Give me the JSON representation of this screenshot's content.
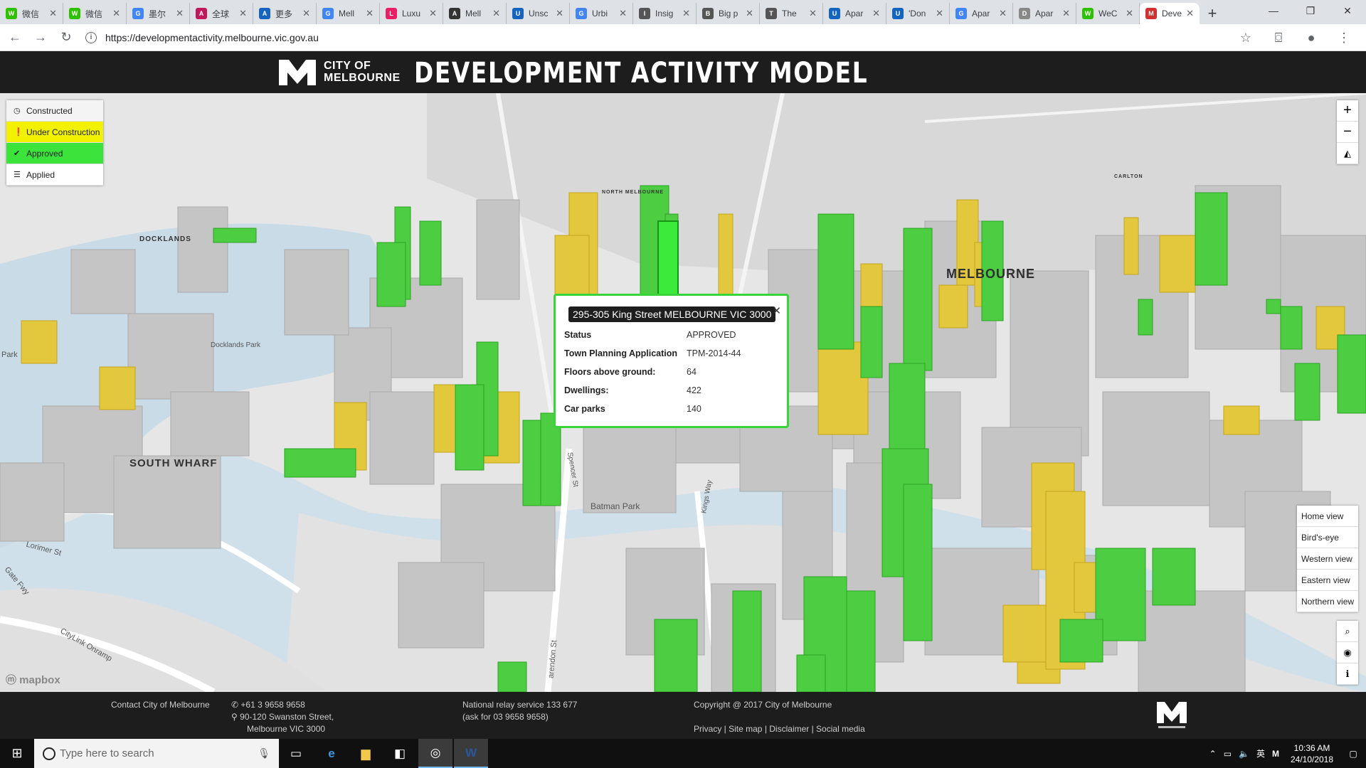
{
  "browser": {
    "tabs": [
      {
        "title": "微信",
        "color": "#2dc100",
        "glyph": "W"
      },
      {
        "title": "微信",
        "color": "#2dc100",
        "glyph": "W"
      },
      {
        "title": "墨尔",
        "color": "#4285f4",
        "glyph": "G"
      },
      {
        "title": "全球",
        "color": "#c2185b",
        "glyph": "A"
      },
      {
        "title": "更多",
        "color": "#1565c0",
        "glyph": "A"
      },
      {
        "title": "Mell",
        "color": "#4285f4",
        "glyph": "G"
      },
      {
        "title": "Luxu",
        "color": "#e91e63",
        "glyph": "L"
      },
      {
        "title": "Mell",
        "color": "#333333",
        "glyph": "A"
      },
      {
        "title": "Unsc",
        "color": "#1565c0",
        "glyph": "U"
      },
      {
        "title": "Urbi",
        "color": "#4285f4",
        "glyph": "G"
      },
      {
        "title": "Insig",
        "color": "#555555",
        "glyph": "I"
      },
      {
        "title": "Big p",
        "color": "#555555",
        "glyph": "B"
      },
      {
        "title": "The",
        "color": "#555555",
        "glyph": "T"
      },
      {
        "title": "Apar",
        "color": "#1565c0",
        "glyph": "U"
      },
      {
        "title": "'Don",
        "color": "#1565c0",
        "glyph": "U"
      },
      {
        "title": "Apar",
        "color": "#4285f4",
        "glyph": "G"
      },
      {
        "title": "Apar",
        "color": "#888888",
        "glyph": "D"
      },
      {
        "title": "WeC",
        "color": "#2dc100",
        "glyph": "W"
      },
      {
        "title": "Deve",
        "color": "#d32f2f",
        "glyph": "M"
      }
    ],
    "url": "https://developmentactivity.melbourne.vic.gov.au"
  },
  "header": {
    "logo_line1": "CITY OF",
    "logo_line2": "MELBOURNE",
    "title": "DEVELOPMENT ACTIVITY MODEL"
  },
  "legend": {
    "items": [
      {
        "label": "Constructed",
        "icon": "clock-icon",
        "bg": "#f4f4f4",
        "glyph": "◷"
      },
      {
        "label": "Under Construction",
        "icon": "warning-icon",
        "bg": "#f2f200",
        "glyph": "❗"
      },
      {
        "label": "Approved",
        "icon": "check-icon",
        "bg": "#3be33b",
        "glyph": "✔"
      },
      {
        "label": "Applied",
        "icon": "list-icon",
        "bg": "#ffffff",
        "glyph": "☰"
      }
    ]
  },
  "map": {
    "labels": {
      "docklands": "DOCKLANDS",
      "melbourne": "MELBOURNE",
      "south_wharf": "SOUTH WHARF",
      "batman_park": "Batman Park",
      "docklands_park": "Docklands Park",
      "park": "Park",
      "spencer_st": "Spencer St",
      "kings_way": "Kings Way",
      "lorimer_st": "Lorimer St",
      "citylink": "CityLink Onramp",
      "gate_fwy": "Gate Fwy",
      "clarendon_st": "arendon St",
      "carlton": "CARLTON",
      "north_melbourne": "NORTH MELBOURNE"
    },
    "attribution": "mapbox",
    "popup": {
      "address": "295-305 King Street MELBOURNE VIC 3000",
      "rows": [
        {
          "key": "Status",
          "value": "APPROVED"
        },
        {
          "key": "Town Planning Application",
          "value": "TPM-2014-44"
        },
        {
          "key": "Floors above ground:",
          "value": "64"
        },
        {
          "key": "Dwellings:",
          "value": "422"
        },
        {
          "key": "Car parks",
          "value": "140"
        }
      ]
    },
    "views": [
      "Home view",
      "Bird's-eye",
      "Western view",
      "Eastern view",
      "Northern view"
    ]
  },
  "footer": {
    "contact": "Contact City of Melbourne",
    "phone": "+61 3 9658 9658",
    "address1": "90-120 Swanston Street,",
    "address2": "Melbourne VIC 3000",
    "relay1": "National relay service 133 677",
    "relay2": "(ask for 03 9658 9658)",
    "copyright": "Copyright @ 2017 City of Melbourne",
    "links": "Privacy | Site map | Disclaimer | Social media"
  },
  "taskbar": {
    "search_placeholder": "Type here to search",
    "time": "10:36 AM",
    "date": "24/10/2018",
    "ime": "英"
  }
}
